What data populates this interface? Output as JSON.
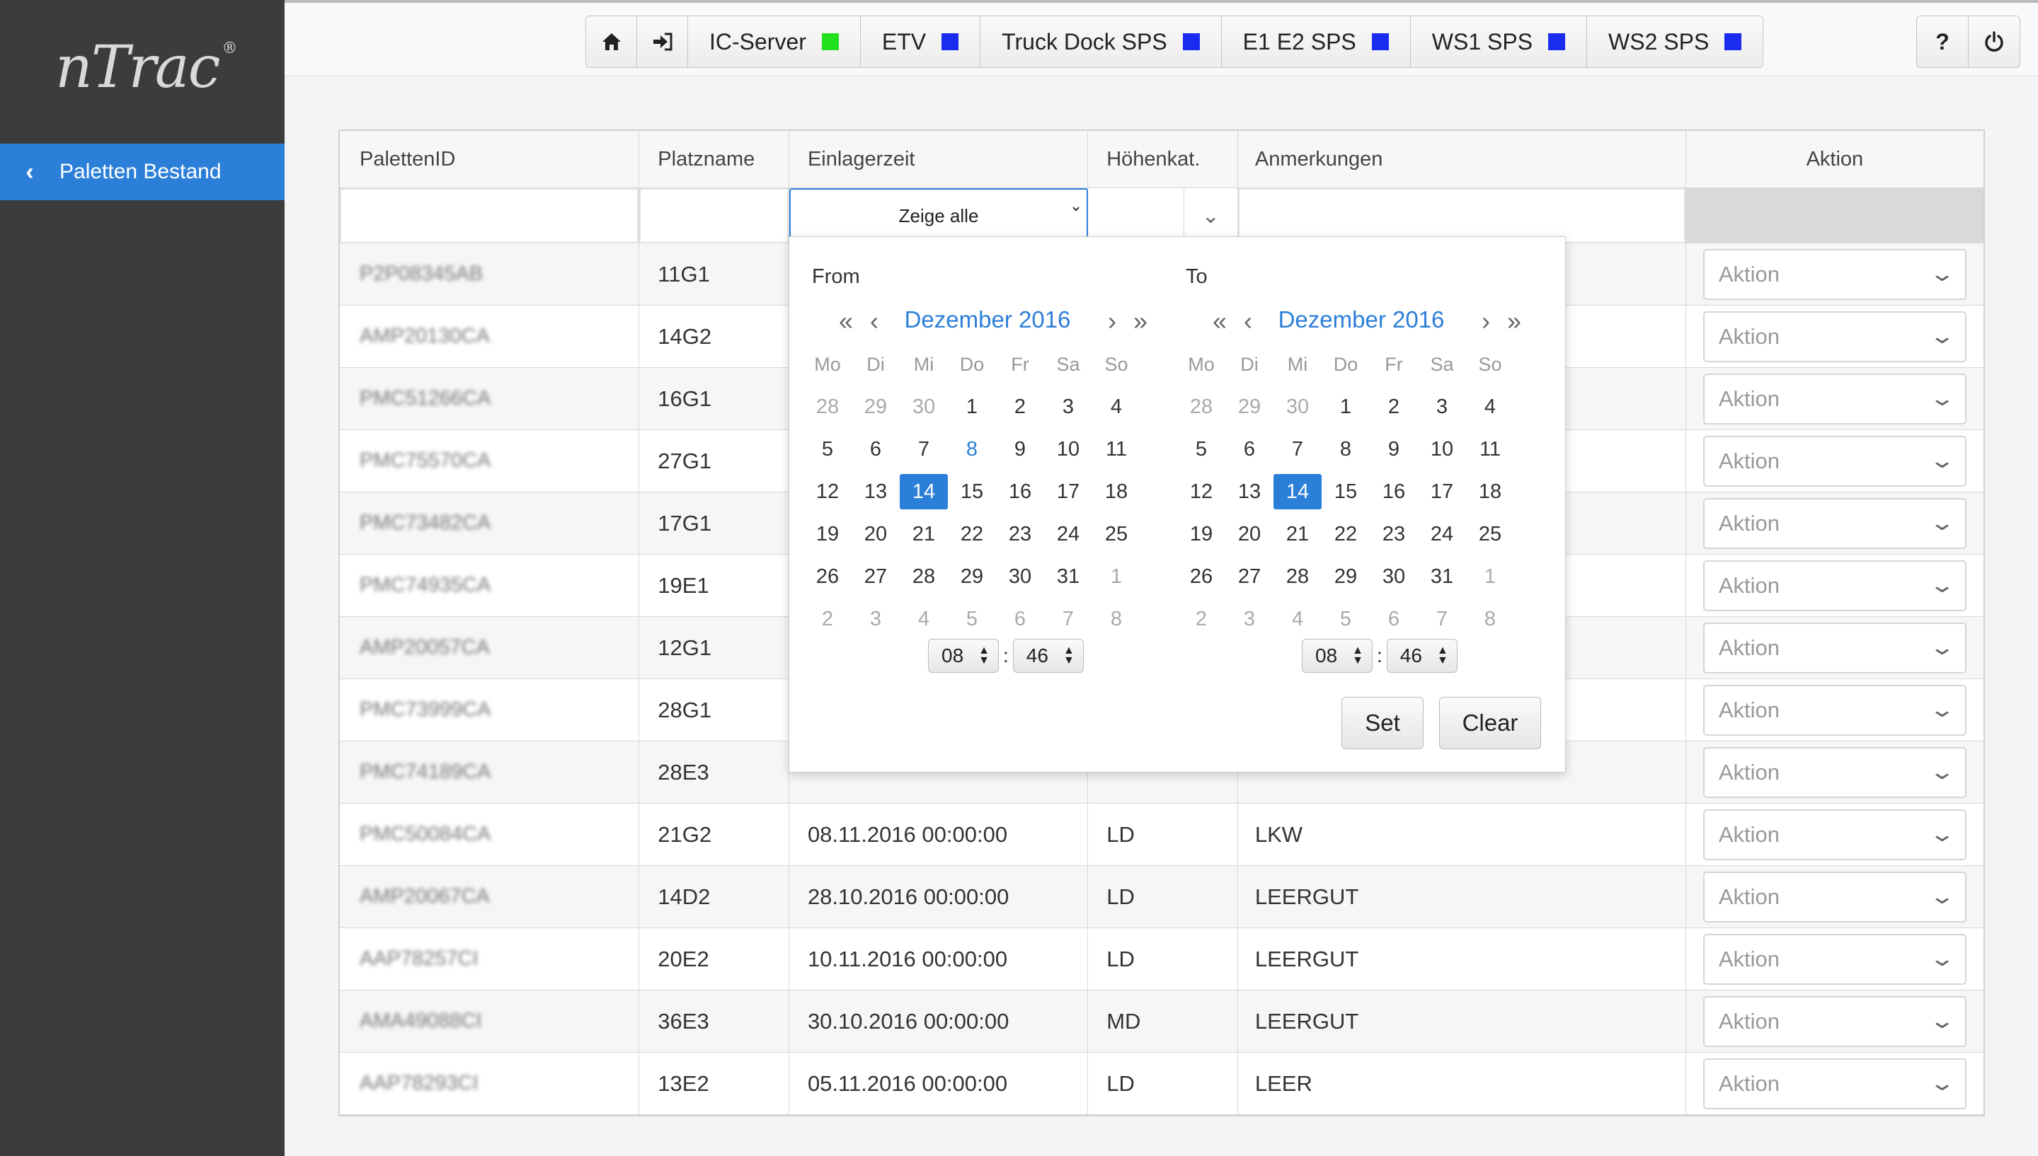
{
  "brand": {
    "logo": "nTrac",
    "reg": "®"
  },
  "sidebar": {
    "items": [
      {
        "label": "Paletten Bestand"
      }
    ]
  },
  "topbar": {
    "status": [
      {
        "label": "IC-Server",
        "color": "#22e01e"
      },
      {
        "label": "ETV",
        "color": "#1a2cf0"
      },
      {
        "label": "Truck Dock SPS",
        "color": "#1a2cf0"
      },
      {
        "label": "E1 E2 SPS",
        "color": "#1a2cf0"
      },
      {
        "label": "WS1 SPS",
        "color": "#1a2cf0"
      },
      {
        "label": "WS2 SPS",
        "color": "#1a2cf0"
      }
    ],
    "help": "?"
  },
  "table": {
    "headers": [
      "PalettenID",
      "Platzname",
      "Einlagerzeit",
      "Höhenkat.",
      "Anmerkungen",
      "Aktion"
    ],
    "filter": {
      "einlagerzeit": "Zeige alle"
    },
    "action_label": "Aktion",
    "rows": [
      {
        "id": "P2P08345AB",
        "platz": "11G1",
        "zeit": "",
        "hoehe": "",
        "anm": ""
      },
      {
        "id": "AMP20130CA",
        "platz": "14G2",
        "zeit": "",
        "hoehe": "",
        "anm": ""
      },
      {
        "id": "PMC51266CA",
        "platz": "16G1",
        "zeit": "",
        "hoehe": "",
        "anm": ""
      },
      {
        "id": "PMC75570CA",
        "platz": "27G1",
        "zeit": "",
        "hoehe": "",
        "anm": ""
      },
      {
        "id": "PMC73482CA",
        "platz": "17G1",
        "zeit": "",
        "hoehe": "",
        "anm": ""
      },
      {
        "id": "PMC74935CA",
        "platz": "19E1",
        "zeit": "",
        "hoehe": "",
        "anm": ""
      },
      {
        "id": "AMP20057CA",
        "platz": "12G1",
        "zeit": "",
        "hoehe": "",
        "anm": ""
      },
      {
        "id": "PMC73999CA",
        "platz": "28G1",
        "zeit": "",
        "hoehe": "",
        "anm": ""
      },
      {
        "id": "PMC74189CA",
        "platz": "28E3",
        "zeit": "",
        "hoehe": "",
        "anm": ""
      },
      {
        "id": "PMC50084CA",
        "platz": "21G2",
        "zeit": "08.11.2016 00:00:00",
        "hoehe": "LD",
        "anm": "LKW"
      },
      {
        "id": "AMP20067CA",
        "platz": "14D2",
        "zeit": "28.10.2016 00:00:00",
        "hoehe": "LD",
        "anm": "LEERGUT"
      },
      {
        "id": "AAP78257CI",
        "platz": "20E2",
        "zeit": "10.11.2016 00:00:00",
        "hoehe": "LD",
        "anm": "LEERGUT"
      },
      {
        "id": "AMA49088CI",
        "platz": "36E3",
        "zeit": "30.10.2016 00:00:00",
        "hoehe": "MD",
        "anm": "LEERGUT"
      },
      {
        "id": "AAP78293CI",
        "platz": "13E2",
        "zeit": "05.11.2016 00:00:00",
        "hoehe": "LD",
        "anm": "LEER"
      }
    ]
  },
  "picker": {
    "from": {
      "title": "From",
      "month": "Dezember 2016",
      "hour": "08",
      "minute": "46"
    },
    "to": {
      "title": "To",
      "month": "Dezember 2016",
      "hour": "08",
      "minute": "46"
    },
    "weekdays": [
      "Mo",
      "Di",
      "Mi",
      "Do",
      "Fr",
      "Sa",
      "So"
    ],
    "days": [
      [
        "28",
        "29",
        "30",
        "1",
        "2",
        "3",
        "4"
      ],
      [
        "5",
        "6",
        "7",
        "8",
        "9",
        "10",
        "11"
      ],
      [
        "12",
        "13",
        "14",
        "15",
        "16",
        "17",
        "18"
      ],
      [
        "19",
        "20",
        "21",
        "22",
        "23",
        "24",
        "25"
      ],
      [
        "26",
        "27",
        "28",
        "29",
        "30",
        "31",
        "1"
      ],
      [
        "2",
        "3",
        "4",
        "5",
        "6",
        "7",
        "8"
      ]
    ],
    "set": "Set",
    "clear": "Clear"
  }
}
